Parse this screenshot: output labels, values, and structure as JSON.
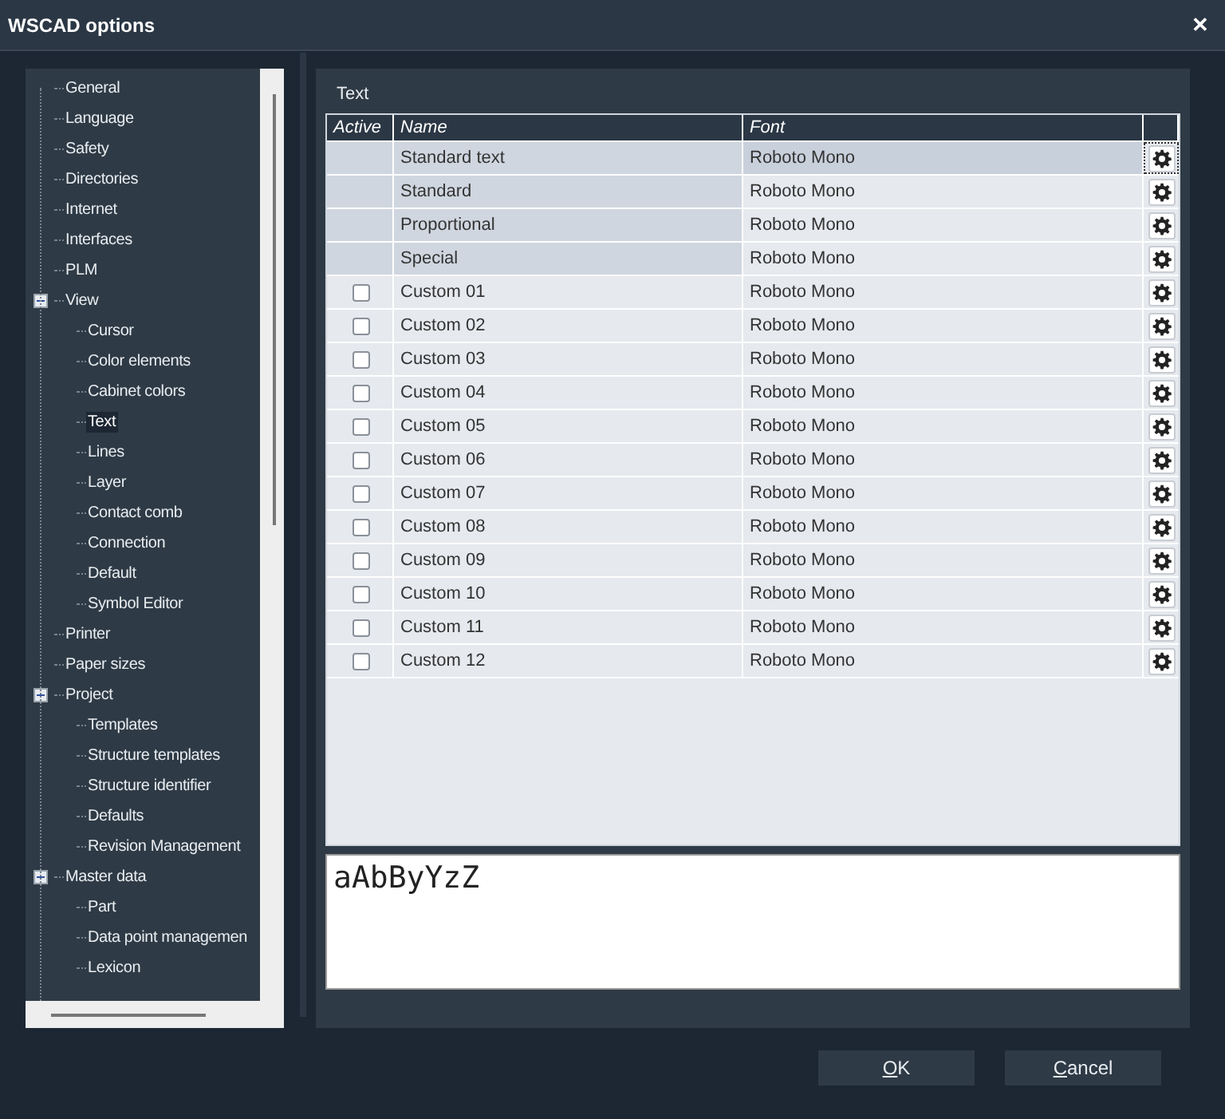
{
  "window": {
    "title": "WSCAD options",
    "close": "✕"
  },
  "tree": [
    {
      "label": "General",
      "selected": false
    },
    {
      "label": "Language",
      "selected": false
    },
    {
      "label": "Safety",
      "selected": false
    },
    {
      "label": "Directories",
      "selected": false
    },
    {
      "label": "Internet",
      "selected": false
    },
    {
      "label": "Interfaces",
      "selected": false
    },
    {
      "label": "PLM",
      "selected": false
    },
    {
      "label": "View",
      "selected": false,
      "expanded": true,
      "children": [
        {
          "label": "Cursor",
          "selected": false
        },
        {
          "label": "Color elements",
          "selected": false
        },
        {
          "label": "Cabinet colors",
          "selected": false
        },
        {
          "label": "Text",
          "selected": true
        },
        {
          "label": "Lines",
          "selected": false
        },
        {
          "label": "Layer",
          "selected": false
        },
        {
          "label": "Contact comb",
          "selected": false
        },
        {
          "label": "Connection",
          "selected": false
        },
        {
          "label": "Default",
          "selected": false
        },
        {
          "label": "Symbol Editor",
          "selected": false
        }
      ]
    },
    {
      "label": "Printer",
      "selected": false
    },
    {
      "label": "Paper sizes",
      "selected": false
    },
    {
      "label": "Project",
      "selected": false,
      "expanded": true,
      "children": [
        {
          "label": "Templates",
          "selected": false
        },
        {
          "label": "Structure templates",
          "selected": false
        },
        {
          "label": "Structure identifier",
          "selected": false
        },
        {
          "label": "Defaults",
          "selected": false
        },
        {
          "label": "Revision Management",
          "selected": false
        }
      ]
    },
    {
      "label": "Master data",
      "selected": false,
      "expanded": true,
      "children": [
        {
          "label": "Part",
          "selected": false
        },
        {
          "label": "Data point managemen",
          "selected": false
        },
        {
          "label": "Lexicon",
          "selected": false
        }
      ]
    }
  ],
  "panel": {
    "title": "Text"
  },
  "table": {
    "columns": [
      "Active",
      "Name",
      "Font"
    ],
    "rows": [
      {
        "kind": "builtin",
        "name": "Standard text",
        "font": "Roboto Mono",
        "selected": true
      },
      {
        "kind": "builtin",
        "name": "Standard",
        "font": "Roboto Mono",
        "selected": false
      },
      {
        "kind": "builtin",
        "name": "Proportional",
        "font": "Roboto Mono",
        "selected": false
      },
      {
        "kind": "builtin",
        "name": "Special",
        "font": "Roboto Mono",
        "selected": false
      },
      {
        "kind": "custom",
        "name": "Custom 01",
        "font": "Roboto Mono",
        "checked": false,
        "selected": false
      },
      {
        "kind": "custom",
        "name": "Custom 02",
        "font": "Roboto Mono",
        "checked": false,
        "selected": false
      },
      {
        "kind": "custom",
        "name": "Custom 03",
        "font": "Roboto Mono",
        "checked": false,
        "selected": false
      },
      {
        "kind": "custom",
        "name": "Custom 04",
        "font": "Roboto Mono",
        "checked": false,
        "selected": false
      },
      {
        "kind": "custom",
        "name": "Custom 05",
        "font": "Roboto Mono",
        "checked": false,
        "selected": false
      },
      {
        "kind": "custom",
        "name": "Custom 06",
        "font": "Roboto Mono",
        "checked": false,
        "selected": false
      },
      {
        "kind": "custom",
        "name": "Custom 07",
        "font": "Roboto Mono",
        "checked": false,
        "selected": false
      },
      {
        "kind": "custom",
        "name": "Custom 08",
        "font": "Roboto Mono",
        "checked": false,
        "selected": false
      },
      {
        "kind": "custom",
        "name": "Custom 09",
        "font": "Roboto Mono",
        "checked": false,
        "selected": false
      },
      {
        "kind": "custom",
        "name": "Custom 10",
        "font": "Roboto Mono",
        "checked": false,
        "selected": false
      },
      {
        "kind": "custom",
        "name": "Custom 11",
        "font": "Roboto Mono",
        "checked": false,
        "selected": false
      },
      {
        "kind": "custom",
        "name": "Custom 12",
        "font": "Roboto Mono",
        "checked": false,
        "selected": false
      }
    ]
  },
  "preview": {
    "sample": "aAbByYzZ"
  },
  "buttons": [
    {
      "label": "OK"
    },
    {
      "label": "Cancel"
    }
  ]
}
